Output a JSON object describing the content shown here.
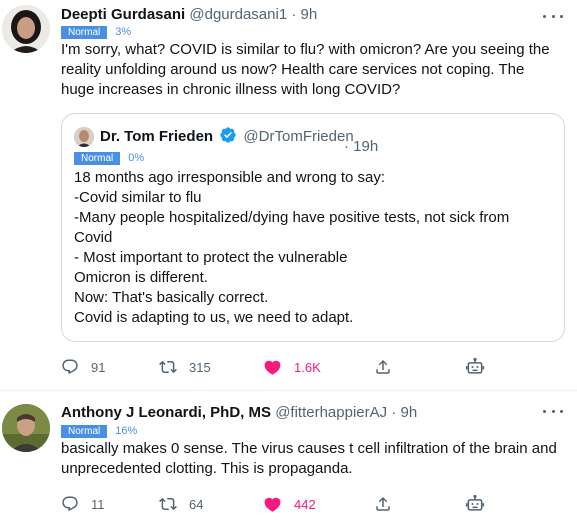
{
  "colors": {
    "badge_bg": "#4a90e2",
    "like_pink": "#f91880",
    "secondary_text": "#536471",
    "verified_blue": "#1d9bf0"
  },
  "tweet1": {
    "author": "Deepti Gurdasani",
    "handle": "@dgurdasani1",
    "separator": "·",
    "time": "9h",
    "badge": "Normal",
    "badge_pct": "3%",
    "text": "I'm sorry, what? COVID is similar to flu? with omicron? Are you seeing the reality unfolding around us now? Health care services not coping. The huge increases in chronic illness with long COVID?",
    "quote": {
      "author": "Dr. Tom Frieden",
      "handle": "@DrTomFrieden",
      "time": "· 19h",
      "badge": "Normal",
      "badge_pct": "0%",
      "lines": [
        "18 months ago irresponsible and wrong to say:",
        "-Covid similar to flu",
        "-Many people hospitalized/dying have positive tests, not sick from",
        "Covid",
        "- Most important to protect the vulnerable",
        "Omicron is different.",
        "Now: That's basically correct.",
        "Covid is adapting to us, we need to adapt."
      ]
    },
    "actions": {
      "reply_icon": "reply-icon",
      "replies": "91",
      "retweet_icon": "retweet-icon",
      "retweets": "315",
      "like_icon": "heart-filled-icon",
      "likes": "1.6K",
      "share_icon": "share-icon",
      "bot_icon": "robot-icon"
    }
  },
  "tweet2": {
    "author": "Anthony J Leonardi, PhD, MS",
    "handle": "@fitterhappierAJ",
    "separator": "·",
    "time": "9h",
    "badge": "Normal",
    "badge_pct": "16%",
    "text": "basically makes 0 sense. The virus causes t cell infiltration of the brain and unprecedented clotting. This is propaganda.",
    "actions": {
      "reply_icon": "reply-icon",
      "replies": "11",
      "retweet_icon": "retweet-icon",
      "retweets": "64",
      "like_icon": "heart-filled-icon",
      "likes": "442",
      "share_icon": "share-icon",
      "bot_icon": "robot-icon"
    }
  }
}
